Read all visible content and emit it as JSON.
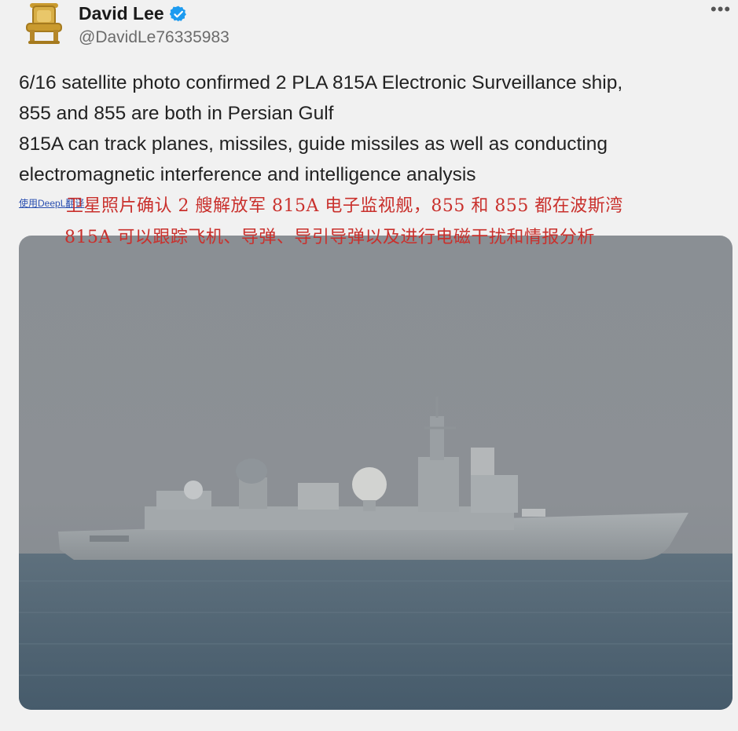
{
  "author": {
    "name": "David Lee",
    "handle": "@DavidLe76335983",
    "avatar_icon": "golden-throne-icon",
    "verified_icon": "verified-badge-icon",
    "verified_color": "#1d9bf0"
  },
  "more_icon": "more-options-icon",
  "tweet": {
    "lines": [
      "6/16 satellite photo confirmed 2 PLA 815A Electronic Surveillance ship,",
      "855 and 855 are both in Persian Gulf",
      "815A can track planes, missiles, guide missiles as well as conducting",
      "electromagnetic interference and intelligence analysis"
    ]
  },
  "translation": {
    "source_label": "使用DeepL翻译",
    "line1": "卫星照片确认 2 艘解放军 815A 电子监视舰，855 和 855 都在波斯湾",
    "line2": "815A 可以跟踪飞机、导弹、导引导弹以及进行电磁干扰和情报分析",
    "color": "#c9302c"
  },
  "media": {
    "subject": "gray naval surveillance ship at sea in haze",
    "sky_color": "#8f9499",
    "sea_color": "#4f6474",
    "ship_color": "#9ea3a6"
  }
}
